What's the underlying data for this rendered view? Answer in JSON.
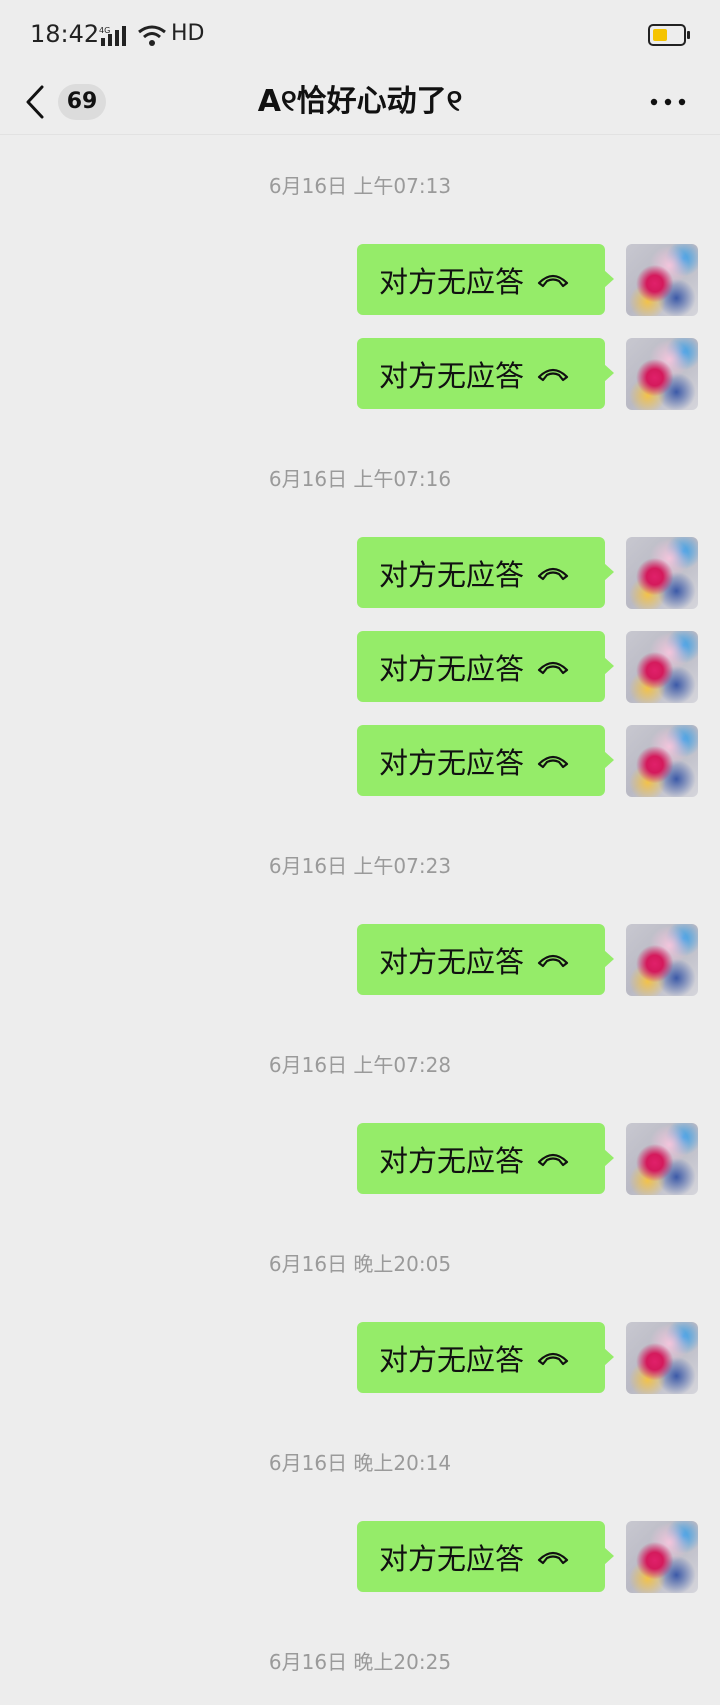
{
  "status_bar": {
    "time": "18:42",
    "network_label": "HD"
  },
  "nav": {
    "unread_count": "69",
    "title": "A୧恰好心动了୧"
  },
  "messages": [
    {
      "kind": "timestamp",
      "text": "6月16日 上午07:13"
    },
    {
      "kind": "call",
      "text": "对方无应答"
    },
    {
      "kind": "call",
      "text": "对方无应答"
    },
    {
      "kind": "timestamp",
      "text": "6月16日 上午07:16"
    },
    {
      "kind": "call",
      "text": "对方无应答"
    },
    {
      "kind": "call",
      "text": "对方无应答"
    },
    {
      "kind": "call",
      "text": "对方无应答"
    },
    {
      "kind": "timestamp",
      "text": "6月16日 上午07:23"
    },
    {
      "kind": "call",
      "text": "对方无应答"
    },
    {
      "kind": "timestamp",
      "text": "6月16日 上午07:28"
    },
    {
      "kind": "call",
      "text": "对方无应答"
    },
    {
      "kind": "timestamp",
      "text": "6月16日 晚上20:05"
    },
    {
      "kind": "call",
      "text": "对方无应答"
    },
    {
      "kind": "timestamp",
      "text": "6月16日 晚上20:14"
    },
    {
      "kind": "call",
      "text": "对方无应答"
    },
    {
      "kind": "timestamp",
      "text": "6月16日 晚上20:25"
    }
  ],
  "colors": {
    "background": "#ededed",
    "bubble": "#95ec69",
    "timestamp_text": "#9a9a9a",
    "battery_fill": "#f5c400"
  },
  "icons": {
    "back": "chevron-left-icon",
    "more": "more-horizontal-icon",
    "call": "hangup-phone-icon",
    "signal": "signal-icon",
    "wifi": "wifi-icon",
    "battery": "battery-icon"
  }
}
